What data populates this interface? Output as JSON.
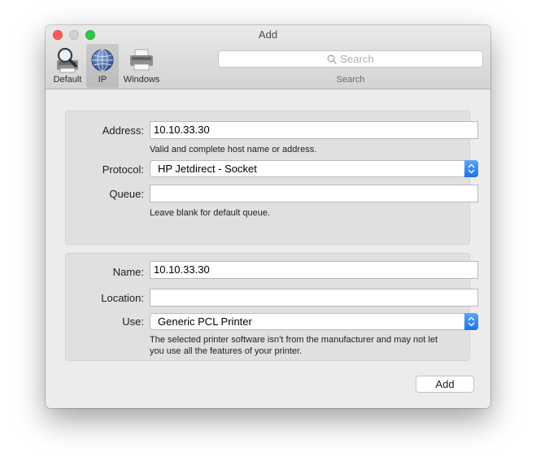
{
  "window": {
    "title": "Add"
  },
  "toolbar": {
    "items": [
      {
        "label": "Default",
        "icon": "magnifier-printer-icon"
      },
      {
        "label": "IP",
        "icon": "globe-icon",
        "selected": true
      },
      {
        "label": "Windows",
        "icon": "windows-printer-icon"
      }
    ],
    "search": {
      "placeholder": "Search",
      "label": "Search"
    }
  },
  "connection": {
    "address_label": "Address:",
    "address_value": "10.10.33.30",
    "address_hint": "Valid and complete host name or address.",
    "protocol_label": "Protocol:",
    "protocol_value": "HP Jetdirect - Socket",
    "queue_label": "Queue:",
    "queue_value": "",
    "queue_hint": "Leave blank for default queue."
  },
  "printer": {
    "name_label": "Name:",
    "name_value": "10.10.33.30",
    "location_label": "Location:",
    "location_value": "",
    "use_label": "Use:",
    "use_value": "Generic PCL Printer",
    "use_hint_line1": "The selected printer software isn’t from the manufacturer and may not let",
    "use_hint_line2": "you use all the features of your printer."
  },
  "footer": {
    "add_label": "Add"
  },
  "colors": {
    "close": "#fc5f57",
    "maximize": "#33c748",
    "select_accent": "#1a72e6"
  }
}
